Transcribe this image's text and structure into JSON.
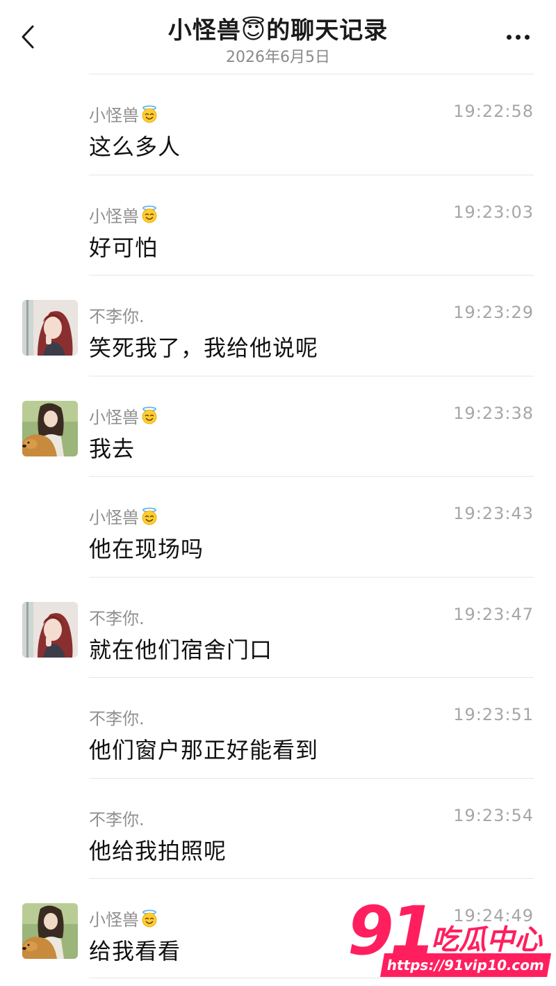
{
  "header": {
    "back_icon": "chevron-left-icon",
    "title": "小怪兽😇的聊天记录",
    "subtitle": "2026年6月5日",
    "more_icon": "ellipsis-icon"
  },
  "messages": [
    {
      "sender": "小怪兽",
      "sender_emoji": "smiling-halo-emoji",
      "time": "19:22:58",
      "text": "这么多人",
      "avatar": "none"
    },
    {
      "sender": "小怪兽",
      "sender_emoji": "smiling-halo-emoji",
      "time": "19:23:03",
      "text": "好可怕",
      "avatar": "none"
    },
    {
      "sender": "不李你.",
      "sender_emoji": "",
      "time": "19:23:29",
      "text": "笑死我了，我给他说呢",
      "avatar": "girl-red-hair"
    },
    {
      "sender": "小怪兽",
      "sender_emoji": "smiling-halo-emoji",
      "time": "19:23:38",
      "text": "我去",
      "avatar": "girl-with-dog"
    },
    {
      "sender": "小怪兽",
      "sender_emoji": "smiling-halo-emoji",
      "time": "19:23:43",
      "text": "他在现场吗",
      "avatar": "none"
    },
    {
      "sender": "不李你.",
      "sender_emoji": "",
      "time": "19:23:47",
      "text": "就在他们宿舍门口",
      "avatar": "girl-red-hair"
    },
    {
      "sender": "不李你.",
      "sender_emoji": "",
      "time": "19:23:51",
      "text": "他们窗户那正好能看到",
      "avatar": "none"
    },
    {
      "sender": "不李你.",
      "sender_emoji": "",
      "time": "19:23:54",
      "text": "他给我拍照呢",
      "avatar": "none"
    },
    {
      "sender": "小怪兽",
      "sender_emoji": "smiling-halo-emoji",
      "time": "19:24:49",
      "text": "给我看看",
      "avatar": "girl-with-dog"
    }
  ],
  "watermark": {
    "number": "91",
    "brand": "吃瓜中心",
    "url": "https://91vip10.com"
  },
  "colors": {
    "accent": "#ff1f5e",
    "text": "#111111",
    "meta": "#8f8f8f",
    "divider": "#e6e6e6"
  }
}
